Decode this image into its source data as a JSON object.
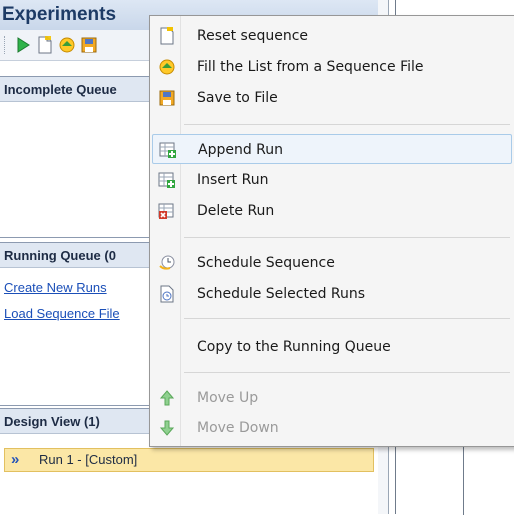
{
  "panel": {
    "title": "Experiments",
    "incomplete_header": "Incomplete Queue",
    "running_header": "Running Queue (0",
    "links": [
      "Create New Runs",
      "Load Sequence File"
    ],
    "design_header": "Design View (1)",
    "run_row_label": "Run 1 - [Custom]"
  },
  "toolbar": {
    "icons": [
      "run-icon",
      "new-file-icon",
      "fill-list-icon",
      "save-icon"
    ]
  },
  "menu": {
    "items": [
      {
        "label": "Reset sequence",
        "icon": "new-document-icon",
        "enabled": true
      },
      {
        "label": "Fill the List from a Sequence File",
        "icon": "fill-list-icon",
        "enabled": true
      },
      {
        "label": "Save to File",
        "icon": "save-disk-icon",
        "enabled": true
      },
      {
        "label": "Append Run",
        "icon": "append-run-icon",
        "enabled": true,
        "highlighted": true
      },
      {
        "label": "Insert Run",
        "icon": "insert-run-icon",
        "enabled": true
      },
      {
        "label": "Delete Run",
        "icon": "delete-run-icon",
        "enabled": true
      },
      {
        "label": "Schedule Sequence",
        "icon": "schedule-icon",
        "enabled": true
      },
      {
        "label": "Schedule Selected Runs",
        "icon": "schedule-selected-icon",
        "enabled": true
      },
      {
        "label": "Copy to the Running Queue",
        "icon": "",
        "enabled": true
      },
      {
        "label": "Move Up",
        "icon": "arrow-up-icon",
        "enabled": false
      },
      {
        "label": "Move Down",
        "icon": "arrow-down-icon",
        "enabled": false
      }
    ]
  },
  "colors": {
    "accent": "#1b4fb8",
    "highlight": "#eef4fb",
    "run_row_bg": "#fbe7a6"
  }
}
